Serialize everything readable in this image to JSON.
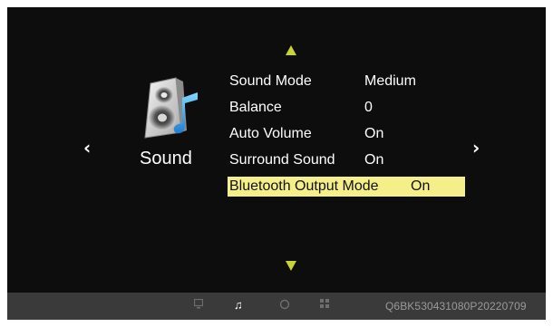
{
  "category": {
    "label": "Sound",
    "icon": "speaker-icon"
  },
  "nav": {
    "left_arrow": "‹",
    "right_arrow": "›",
    "up_icon": "triangle-up-icon",
    "down_icon": "triangle-down-icon"
  },
  "menu": {
    "items": [
      {
        "label": "Sound Mode",
        "value": "Medium"
      },
      {
        "label": "Balance",
        "value": "0"
      },
      {
        "label": "Auto Volume",
        "value": "On"
      },
      {
        "label": "Surround Sound",
        "value": "On"
      },
      {
        "label": "Bluetooth Output Mode",
        "value": "On",
        "selected": true
      }
    ]
  },
  "footer": {
    "icons": [
      "tv-icon",
      "music-icon",
      "clock-icon",
      "apps-icon"
    ],
    "active_icon": "music-icon",
    "serial": "Q6BK530431080P20220709"
  },
  "colors": {
    "background": "#0d0d0d",
    "highlight": "#f5ef8a",
    "arrow": "#c7d531",
    "footer": "#3a3a3a"
  }
}
